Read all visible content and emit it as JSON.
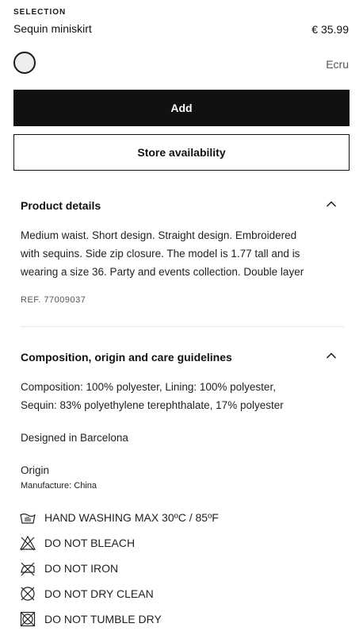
{
  "header": {
    "eyebrow": "SELECTION",
    "product_name": "Sequin miniskirt",
    "price": "€ 35.99",
    "color_name": "Ecru",
    "swatch_color": "#ededeb"
  },
  "actions": {
    "add_label": "Add",
    "store_label": "Store availability"
  },
  "product_details": {
    "title": "Product details",
    "chevron_icon": "chevron-up-icon",
    "description_lines": [
      "Medium waist. Short design. Straight design. Embroidered",
      "with sequins. Side zip closure. The model is 1.77 tall and is",
      "wearing a size 36. Party and events collection. Double layer"
    ],
    "ref": "REF. 77009037"
  },
  "composition": {
    "title": "Composition, origin and care guidelines",
    "chevron_icon": "chevron-up-icon",
    "lines": [
      "Composition: 100% polyester, Lining: 100% polyester,",
      "Sequin: 83% polyethylene terephthalate, 17% polyester"
    ],
    "designed": "Designed in Barcelona",
    "origin_label": "Origin",
    "manufacture": "Manufacture: China",
    "care": [
      {
        "icon": "hand-wash-icon",
        "label": "HAND WASHING MAX 30ºC / 85ºF"
      },
      {
        "icon": "no-bleach-icon",
        "label": "DO NOT BLEACH"
      },
      {
        "icon": "no-iron-icon",
        "label": "DO NOT IRON"
      },
      {
        "icon": "no-dry-clean-icon",
        "label": "DO NOT DRY CLEAN"
      },
      {
        "icon": "no-tumble-dry-icon",
        "label": "DO NOT TUMBLE DRY"
      }
    ]
  }
}
